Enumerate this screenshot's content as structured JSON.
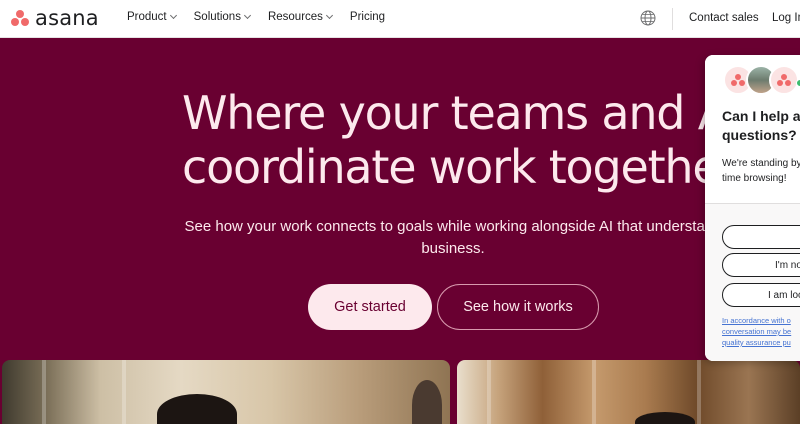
{
  "header": {
    "logo_text": "asana",
    "nav": [
      {
        "label": "Product",
        "has_dropdown": true
      },
      {
        "label": "Solutions",
        "has_dropdown": true
      },
      {
        "label": "Resources",
        "has_dropdown": true
      },
      {
        "label": "Pricing",
        "has_dropdown": false
      }
    ],
    "language_icon": "globe-icon",
    "contact_label": "Contact sales",
    "login_label": "Log In"
  },
  "hero": {
    "headline_line1": "Where your teams and A",
    "headline_line2": "coordinate work togethe",
    "subtitle_line1": "See how your work connects to goals while working alongside AI that understand",
    "subtitle_line2": "business.",
    "primary_cta": "Get started",
    "secondary_cta": "See how it works"
  },
  "chat": {
    "title_line1": "Can I help a",
    "title_line2": "questions?",
    "message_line1": "We're standing by",
    "message_line2": "time browsing!",
    "option1": "",
    "option2": "I'm no",
    "option3": "I am loo",
    "legal_line1": "In accordance with o",
    "legal_line2": "conversation may be",
    "legal_line3": "quality assurance pu"
  },
  "colors": {
    "hero_bg": "#690031",
    "hero_text": "#fde9ed",
    "brand_coral": "#f06a6a",
    "link_blue": "#4573d2",
    "online_green": "#3dbb6f"
  }
}
